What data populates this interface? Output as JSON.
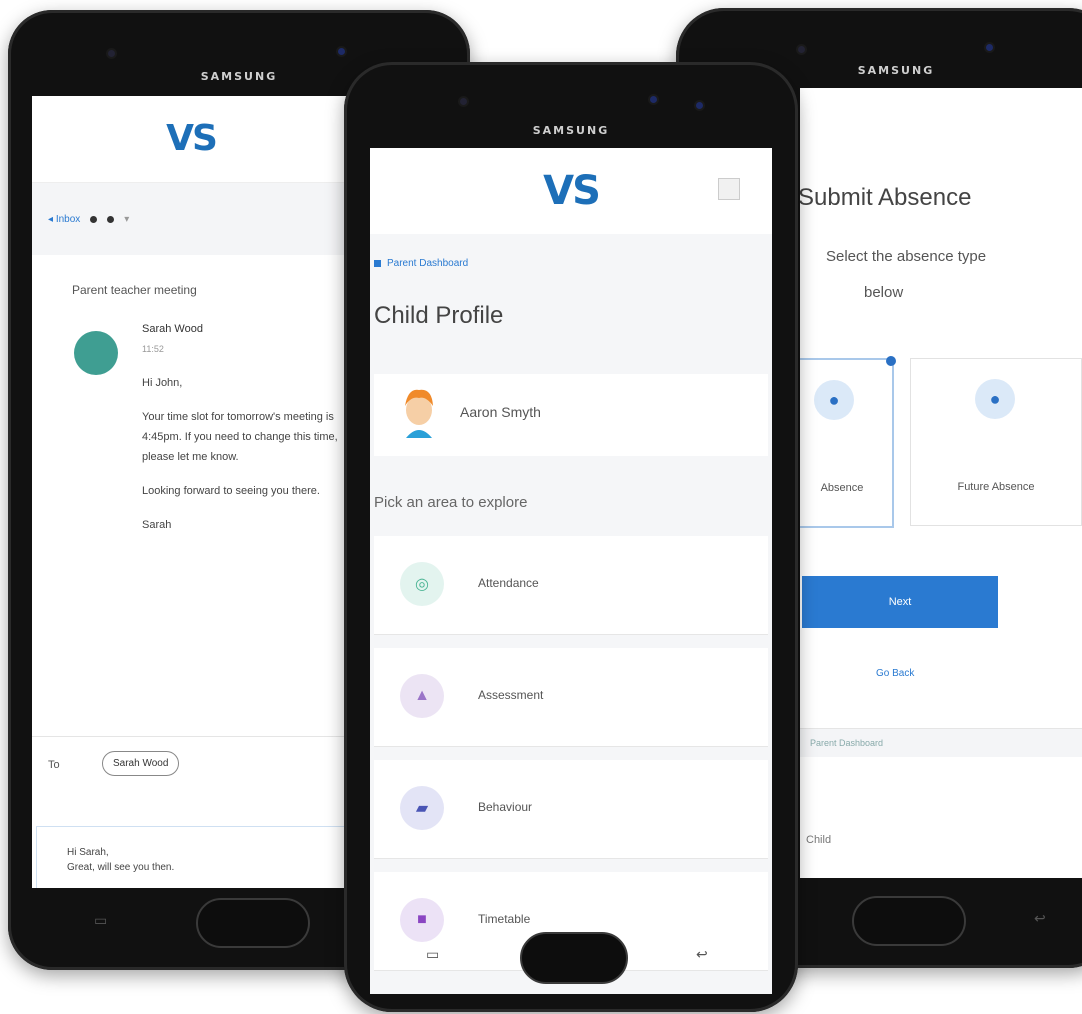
{
  "brand": "SAMSUNG",
  "logo": "VS",
  "left_screen": {
    "back_label": "Inbox",
    "subject": "Parent teacher meeting",
    "sender": "Sarah Wood",
    "time": "11:52",
    "greeting": "Hi John,",
    "paragraph1": "Your time slot for tomorrow's meeting is 4:45pm. If you need to change this time, please let me know.",
    "paragraph2": "Looking forward to seeing you there.",
    "signoff": "Sarah",
    "reply_to_label": "To",
    "recipient_chip": "Sarah Wood",
    "compose_line1": "Hi Sarah,",
    "compose_line2": "Great, will see you then."
  },
  "center_screen": {
    "breadcrumb": "Parent Dashboard",
    "title": "Child Profile",
    "child_name": "Aaron Smyth",
    "pick_prompt": "Pick an area to explore",
    "areas": [
      {
        "label": "Attendance",
        "icon": "attendance-icon",
        "bg": "#e3f4ef",
        "fg": "#4db595"
      },
      {
        "label": "Assessment",
        "icon": "assessment-icon",
        "bg": "#ece4f4",
        "fg": "#9a74c8"
      },
      {
        "label": "Behaviour",
        "icon": "behaviour-icon",
        "bg": "#e3e4f6",
        "fg": "#4a55b5"
      },
      {
        "label": "Timetable",
        "icon": "timetable-icon",
        "bg": "#ece2f6",
        "fg": "#8a45c2"
      }
    ]
  },
  "right_screen": {
    "close": "×",
    "title": "Submit Absence",
    "subtitle_line1": "Select the absence type",
    "subtitle_line2": "below",
    "options": [
      {
        "label": "Absence",
        "selected": true
      },
      {
        "label": "Future Absence",
        "selected": false
      }
    ],
    "next_label": "Next",
    "back_label": "Go Back",
    "footer_link": "Parent Dashboard",
    "input_placeholder": "Child"
  },
  "colors": {
    "accent": "#2a7ad1",
    "logo_dark": "#1d6fb8",
    "logo_light": "#3fa7dc"
  }
}
